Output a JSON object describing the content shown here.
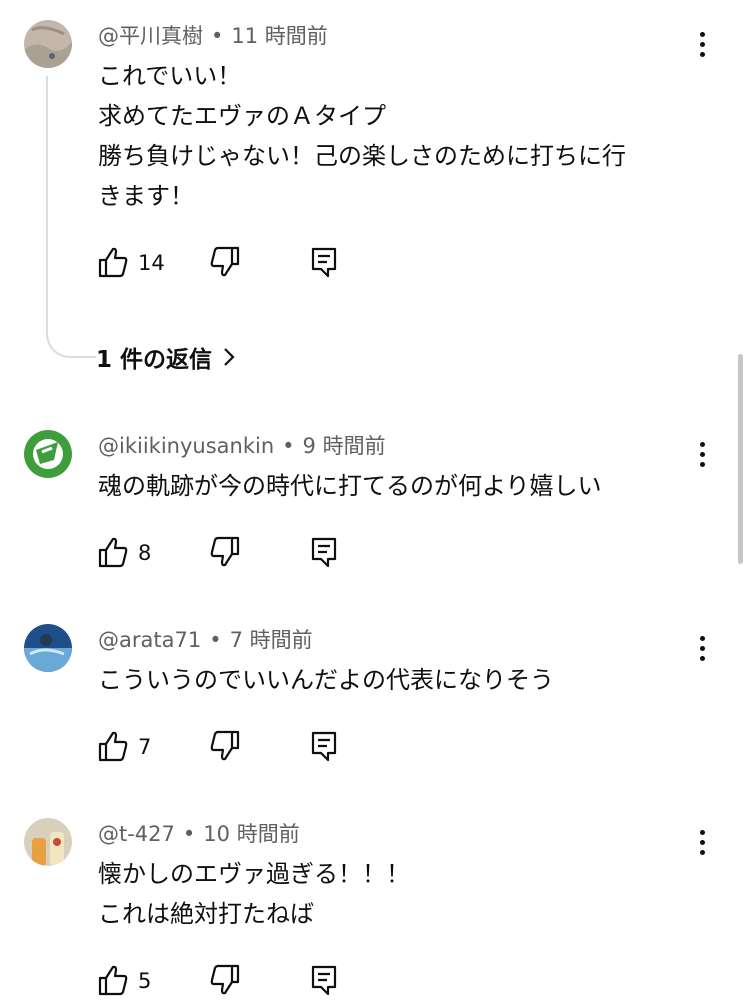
{
  "comments": [
    {
      "author": "@平川真樹",
      "time": "11 時間前",
      "lines": [
        "これでいい！",
        "求めてたエヴァのＡタイプ",
        "勝ち負けじゃない！己の楽しさのために打ちに行",
        "きます！"
      ],
      "likes": "14",
      "replies_label": "1 件の返信",
      "avatar_colors": [
        "#b9a89a",
        "#8f9a8c"
      ]
    },
    {
      "author": "@ikiikinyusankin",
      "time": "9 時間前",
      "lines": [
        "魂の軌跡が今の時代に打てるのが何より嬉しい"
      ],
      "likes": "8",
      "avatar_colors": [
        "#3e9e3e",
        "#ffffff"
      ]
    },
    {
      "author": "@arata71",
      "time": "7 時間前",
      "lines": [
        "こういうのでいいんだよの代表になりそう"
      ],
      "likes": "7",
      "avatar_colors": [
        "#1f4f8a",
        "#69a9d8"
      ]
    },
    {
      "author": "@t-427",
      "time": "10 時間前",
      "lines": [
        "懐かしのエヴァ過ぎる！！！",
        "これは絶対打たねば"
      ],
      "likes": "5",
      "avatar_colors": [
        "#d8c9a0",
        "#e8a040"
      ]
    }
  ],
  "separator": "•",
  "icons": {
    "menu": "more-vertical-icon",
    "like": "thumbs-up-icon",
    "dislike": "thumbs-down-icon",
    "reply": "reply-comment-icon",
    "chevron": "chevron-right-icon"
  },
  "colors": {
    "meta_text": "#606060",
    "thread_line": "#dcdcdc"
  }
}
